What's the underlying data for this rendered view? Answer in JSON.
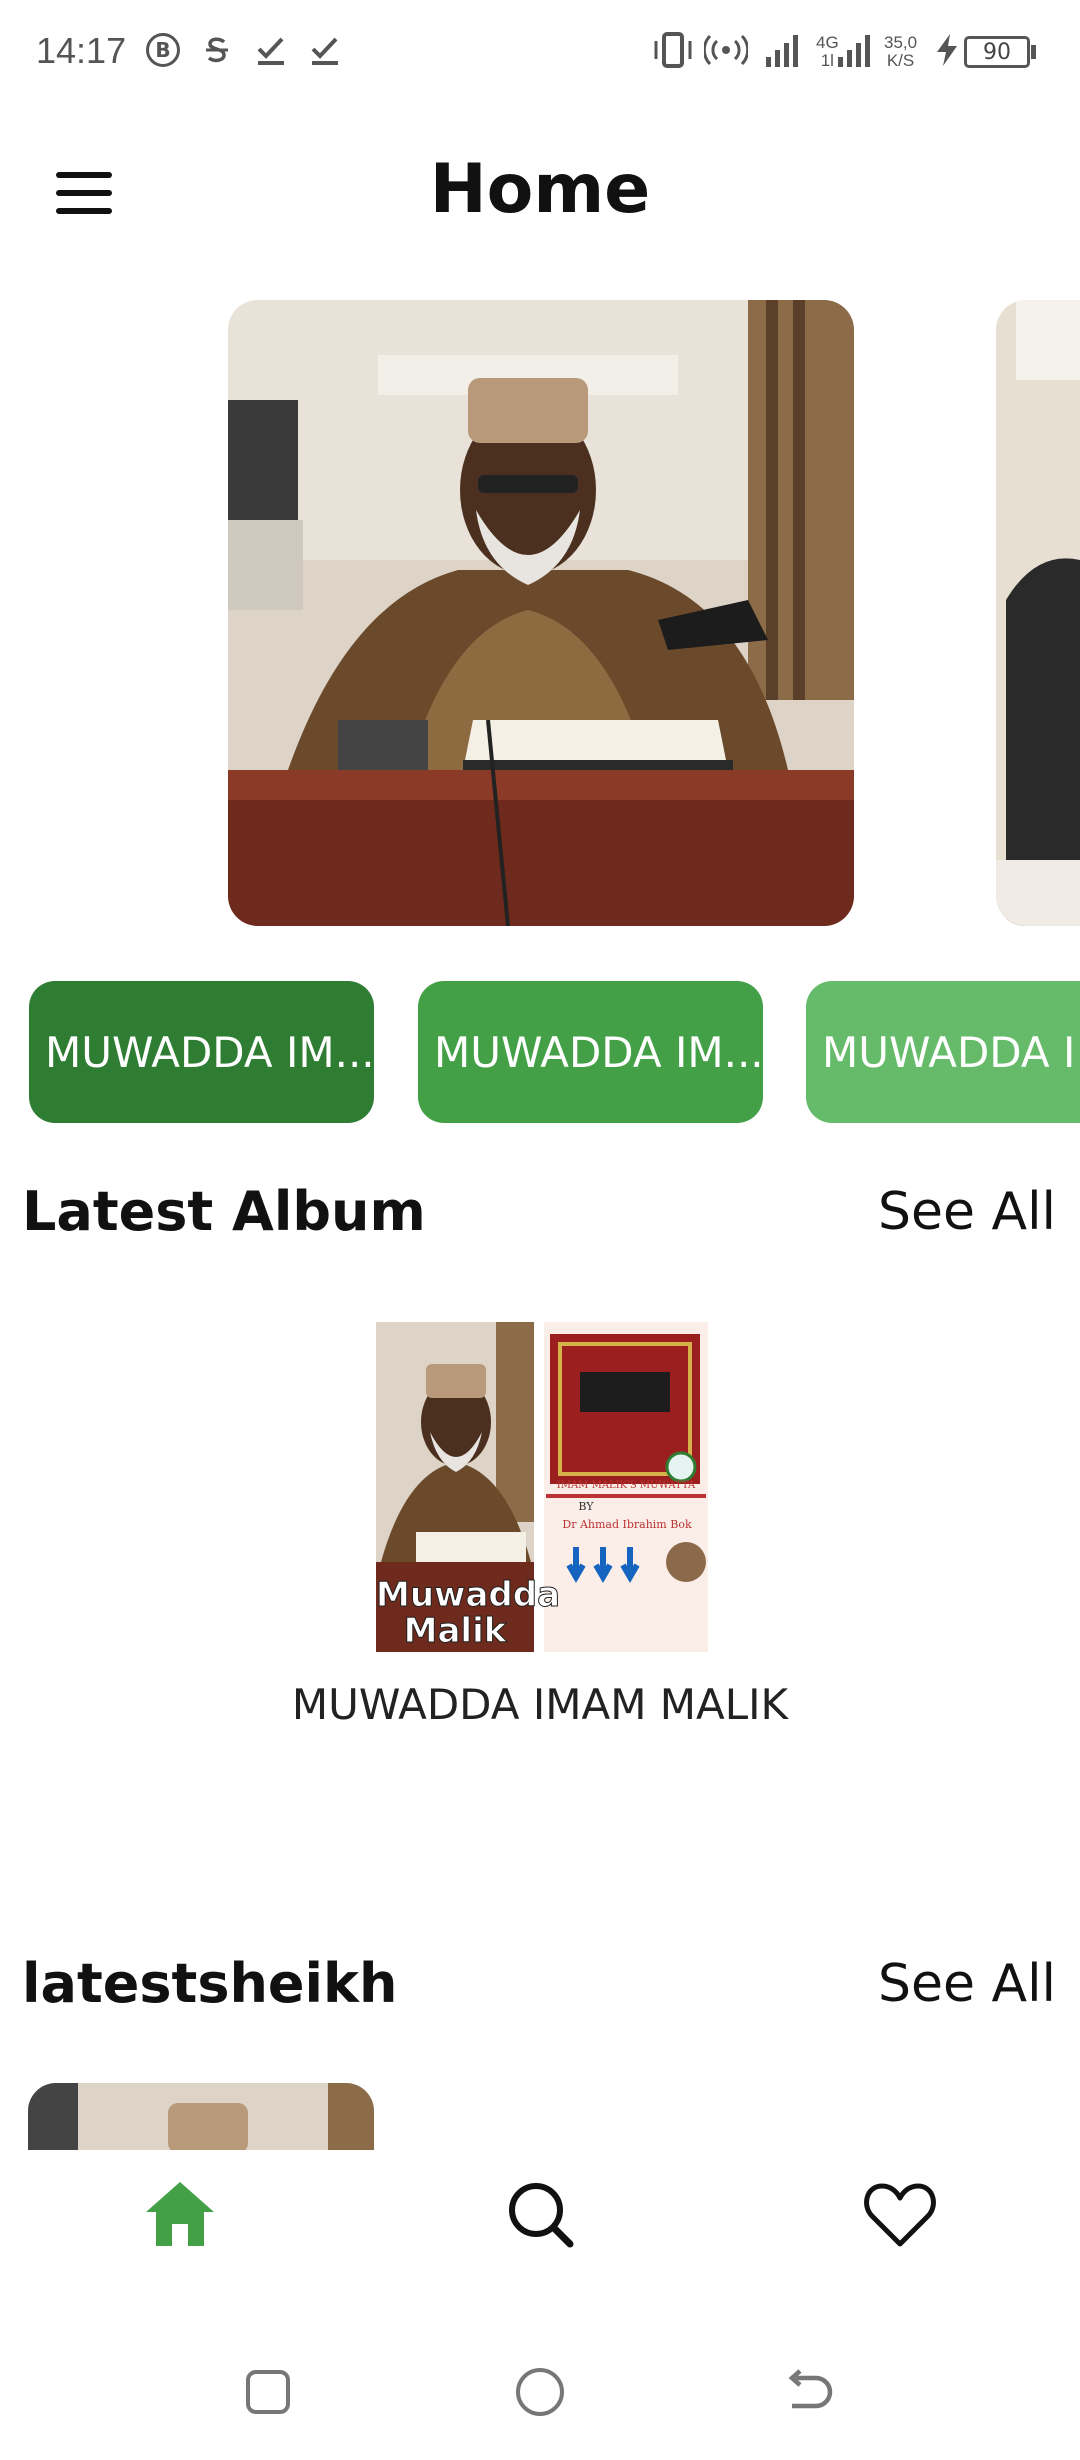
{
  "status_bar": {
    "time": "14:17",
    "icons": [
      "b-circle-icon",
      "s-icon",
      "check-icon",
      "check-icon"
    ],
    "network_top": "4G",
    "network_bottom": "1l",
    "speed_value": "35,0",
    "speed_unit": "K/S",
    "battery": "90"
  },
  "header": {
    "title": "Home",
    "menu_icon": "hamburger-icon"
  },
  "categories": [
    {
      "label": "MUWADDA IM...",
      "color": "#2e7d32"
    },
    {
      "label": "MUWADDA IM...",
      "color": "#43a047"
    },
    {
      "label": "MUWADDA I",
      "color": "#66bb6a"
    }
  ],
  "latest_album": {
    "title": "Latest Album",
    "see_all": "See All",
    "album_name": "MUWADDA IMAM MALIK",
    "cover_left_caption": "Muwadda Malik",
    "cover_right_line1": "IMAM MALIK'S MUWATTA",
    "cover_right_line2": "BY",
    "cover_right_line3": "Dr Ahmad Ibrahim Bok"
  },
  "latest_sheikh": {
    "title": "latestsheikh",
    "see_all": "See All"
  },
  "bottom_nav": {
    "items": [
      "home-icon",
      "search-icon",
      "heart-icon"
    ],
    "active_color": "#43a047"
  }
}
